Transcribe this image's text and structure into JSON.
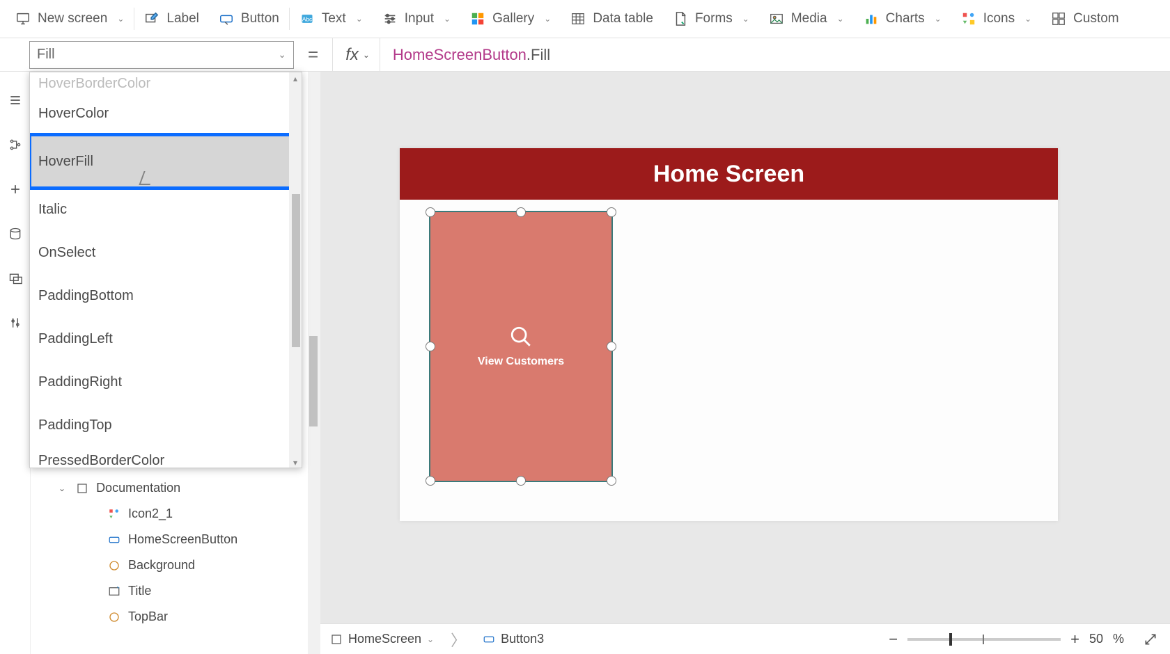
{
  "ribbon": {
    "newScreen": "New screen",
    "label": "Label",
    "button": "Button",
    "text": "Text",
    "input": "Input",
    "gallery": "Gallery",
    "dataTable": "Data table",
    "forms": "Forms",
    "media": "Media",
    "charts": "Charts",
    "icons": "Icons",
    "custom": "Custom"
  },
  "propertySelector": {
    "value": "Fill"
  },
  "fxLabel": "fx",
  "formula": {
    "equals": "=",
    "ref": "HomeScreenButton",
    "prop": ".Fill"
  },
  "propertyDropdown": {
    "items": [
      "HoverColor",
      "HoverFill",
      "Italic",
      "OnSelect",
      "PaddingBottom",
      "PaddingLeft",
      "PaddingRight",
      "PaddingTop",
      "PressedBorderColor"
    ],
    "highlighted": "HoverFill"
  },
  "tree": {
    "group": "Documentation",
    "items": [
      {
        "name": "Icon2_1",
        "icon": "icons"
      },
      {
        "name": "HomeScreenButton",
        "icon": "button"
      },
      {
        "name": "Background",
        "icon": "shape"
      },
      {
        "name": "Title",
        "icon": "label"
      },
      {
        "name": "TopBar",
        "icon": "shape"
      }
    ]
  },
  "canvas": {
    "title": "Home Screen",
    "buttonLabel": "View Customers"
  },
  "breadcrumb": {
    "screen": "HomeScreen",
    "control": "Button3"
  },
  "zoom": {
    "value": "50",
    "unit": "%"
  }
}
